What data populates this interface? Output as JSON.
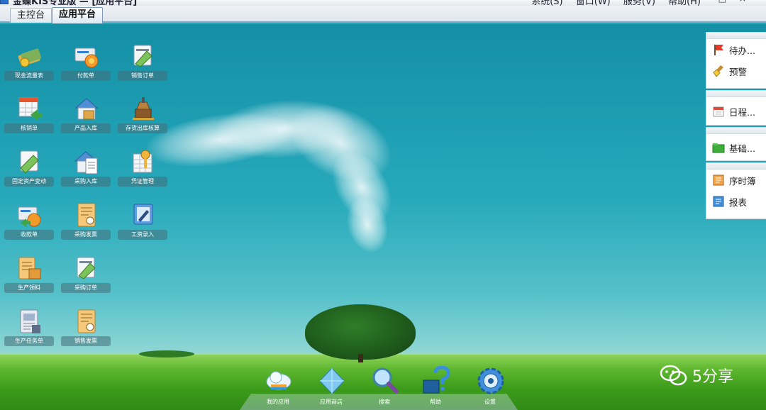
{
  "window": {
    "title": "金蝶KIS专业版 — [应用平台]",
    "menu": [
      "系统(S)",
      "窗口(W)",
      "服务(V)",
      "帮助(H)"
    ],
    "controls": [
      "—",
      "□",
      "×"
    ]
  },
  "tabs": [
    {
      "label": "主控台",
      "active": false
    },
    {
      "label": "应用平台",
      "active": true
    }
  ],
  "apps": [
    {
      "label": "现金流量表",
      "icon": "cash-flow-icon"
    },
    {
      "label": "付款单",
      "icon": "payment-icon"
    },
    {
      "label": "销售订单",
      "icon": "sales-order-icon"
    },
    {
      "label": "核销单",
      "icon": "verification-icon"
    },
    {
      "label": "产品入库",
      "icon": "product-stockin-icon"
    },
    {
      "label": "存货出库核算",
      "icon": "inventory-cost-icon"
    },
    {
      "label": "固定资产变动",
      "icon": "fixed-asset-icon"
    },
    {
      "label": "采购入库",
      "icon": "purchase-stockin-icon"
    },
    {
      "label": "凭证管理",
      "icon": "voucher-icon"
    },
    {
      "label": "收款单",
      "icon": "receipt-icon"
    },
    {
      "label": "采购发票",
      "icon": "purchase-invoice-icon"
    },
    {
      "label": "工资录入",
      "icon": "salary-entry-icon"
    },
    {
      "label": "生产领料",
      "icon": "material-issue-icon"
    },
    {
      "label": "采购订单",
      "icon": "purchase-order-icon"
    },
    {
      "label": "生产任务单",
      "icon": "production-task-icon"
    },
    {
      "label": "销售发票",
      "icon": "sales-invoice-icon"
    }
  ],
  "side_panel": {
    "groups": [
      [
        {
          "label": "待办...",
          "icon": "red-flag-icon"
        },
        {
          "label": "预警",
          "icon": "broom-icon"
        }
      ],
      [
        {
          "label": "日程...",
          "icon": "calendar-icon"
        }
      ],
      [
        {
          "label": "基础...",
          "icon": "green-folder-icon"
        }
      ],
      [
        {
          "label": "序时簿",
          "icon": "orange-ledger-icon"
        },
        {
          "label": "报表",
          "icon": "blue-report-icon"
        }
      ]
    ]
  },
  "dock": [
    {
      "label": "我的应用",
      "icon": "cloud-apps-icon"
    },
    {
      "label": "应用商店",
      "icon": "diamond-store-icon"
    },
    {
      "label": "搜索",
      "icon": "magnifier-icon"
    },
    {
      "label": "帮助",
      "icon": "help-icon"
    },
    {
      "label": "设置",
      "icon": "gear-icon"
    }
  ],
  "watermark": {
    "text": "5分享",
    "icon": "wechat-icon"
  }
}
